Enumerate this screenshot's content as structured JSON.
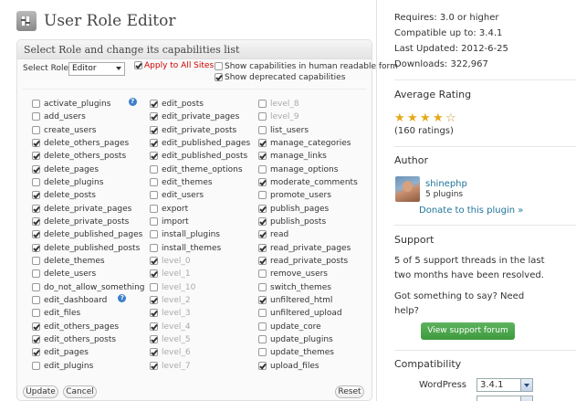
{
  "editor": {
    "title": "User Role Editor",
    "box_header": "Select Role and change its capabilities list",
    "select_role_label": "Select Role:",
    "role_selected": "Editor",
    "apply_all_label": "Apply to All Sites",
    "apply_all_checked": true,
    "human_readable_label": "Show capabilities in human readable form",
    "human_readable_checked": false,
    "deprecated_label": "Show deprecated capabilities",
    "deprecated_checked": true,
    "buttons": {
      "update": "Update",
      "cancel": "Cancel",
      "reset": "Reset"
    },
    "columns": [
      [
        {
          "label": "activate_plugins",
          "checked": false,
          "help": true
        },
        {
          "label": "add_users",
          "checked": false
        },
        {
          "label": "create_users",
          "checked": false
        },
        {
          "label": "delete_others_pages",
          "checked": true
        },
        {
          "label": "delete_others_posts",
          "checked": true
        },
        {
          "label": "delete_pages",
          "checked": true
        },
        {
          "label": "delete_plugins",
          "checked": false
        },
        {
          "label": "delete_posts",
          "checked": true
        },
        {
          "label": "delete_private_pages",
          "checked": true
        },
        {
          "label": "delete_private_posts",
          "checked": true
        },
        {
          "label": "delete_published_pages",
          "checked": true
        },
        {
          "label": "delete_published_posts",
          "checked": true
        },
        {
          "label": "delete_themes",
          "checked": false
        },
        {
          "label": "delete_users",
          "checked": false
        },
        {
          "label": "do_not_allow_something",
          "checked": false
        },
        {
          "label": "edit_dashboard",
          "checked": false,
          "help": true
        },
        {
          "label": "edit_files",
          "checked": false
        },
        {
          "label": "edit_others_pages",
          "checked": true
        },
        {
          "label": "edit_others_posts",
          "checked": true
        },
        {
          "label": "edit_pages",
          "checked": true
        },
        {
          "label": "edit_plugins",
          "checked": false
        }
      ],
      [
        {
          "label": "edit_posts",
          "checked": true
        },
        {
          "label": "edit_private_pages",
          "checked": true
        },
        {
          "label": "edit_private_posts",
          "checked": true
        },
        {
          "label": "edit_published_pages",
          "checked": true
        },
        {
          "label": "edit_published_posts",
          "checked": true
        },
        {
          "label": "edit_theme_options",
          "checked": false
        },
        {
          "label": "edit_themes",
          "checked": false
        },
        {
          "label": "edit_users",
          "checked": false
        },
        {
          "label": "export",
          "checked": false
        },
        {
          "label": "import",
          "checked": false
        },
        {
          "label": "install_plugins",
          "checked": false
        },
        {
          "label": "install_themes",
          "checked": false
        },
        {
          "label": "level_0",
          "checked": true,
          "dim": true
        },
        {
          "label": "level_1",
          "checked": true,
          "dim": true
        },
        {
          "label": "level_10",
          "checked": false,
          "dim": true
        },
        {
          "label": "level_2",
          "checked": true,
          "dim": true
        },
        {
          "label": "level_3",
          "checked": true,
          "dim": true
        },
        {
          "label": "level_4",
          "checked": true,
          "dim": true
        },
        {
          "label": "level_5",
          "checked": true,
          "dim": true
        },
        {
          "label": "level_6",
          "checked": true,
          "dim": true
        },
        {
          "label": "level_7",
          "checked": true,
          "dim": true
        }
      ],
      [
        {
          "label": "level_8",
          "checked": false,
          "dim": true
        },
        {
          "label": "level_9",
          "checked": false,
          "dim": true
        },
        {
          "label": "list_users",
          "checked": false
        },
        {
          "label": "manage_categories",
          "checked": true
        },
        {
          "label": "manage_links",
          "checked": true
        },
        {
          "label": "manage_options",
          "checked": false
        },
        {
          "label": "moderate_comments",
          "checked": true
        },
        {
          "label": "promote_users",
          "checked": false
        },
        {
          "label": "publish_pages",
          "checked": true
        },
        {
          "label": "publish_posts",
          "checked": true
        },
        {
          "label": "read",
          "checked": true
        },
        {
          "label": "read_private_pages",
          "checked": true
        },
        {
          "label": "read_private_posts",
          "checked": true
        },
        {
          "label": "remove_users",
          "checked": false
        },
        {
          "label": "switch_themes",
          "checked": false
        },
        {
          "label": "unfiltered_html",
          "checked": true
        },
        {
          "label": "unfiltered_upload",
          "checked": false
        },
        {
          "label": "update_core",
          "checked": false
        },
        {
          "label": "update_plugins",
          "checked": false
        },
        {
          "label": "update_themes",
          "checked": false
        },
        {
          "label": "upload_files",
          "checked": true
        }
      ]
    ]
  },
  "sidebar": {
    "requires": "Requires: 3.0 or higher",
    "compatible": "Compatible up to: 3.4.1",
    "last_updated": "Last Updated: 2012-6-25",
    "downloads": "Downloads: 322,967",
    "rating_heading": "Average Rating",
    "rating_stars": 4.5,
    "rating_count": "(160 ratings)",
    "author_heading": "Author",
    "author_name": "shinephp",
    "author_plugins": "5 plugins",
    "donate": "Donate to this plugin »",
    "support_heading": "Support",
    "support_text_1": "5 of 5 support threads in the last",
    "support_text_2": "two months have been resolved.",
    "say_1": "Got something to say? Need",
    "say_2": "help?",
    "forum_button": "View support forum",
    "compat_heading": "Compatibility",
    "compat_wp_label": "WordPress",
    "compat_wp_value": "3.4.1"
  },
  "colors": {
    "link": "#21759b",
    "apply_all": "#d00000",
    "forum_button": "#4aa54a",
    "star": "#e6a817"
  }
}
